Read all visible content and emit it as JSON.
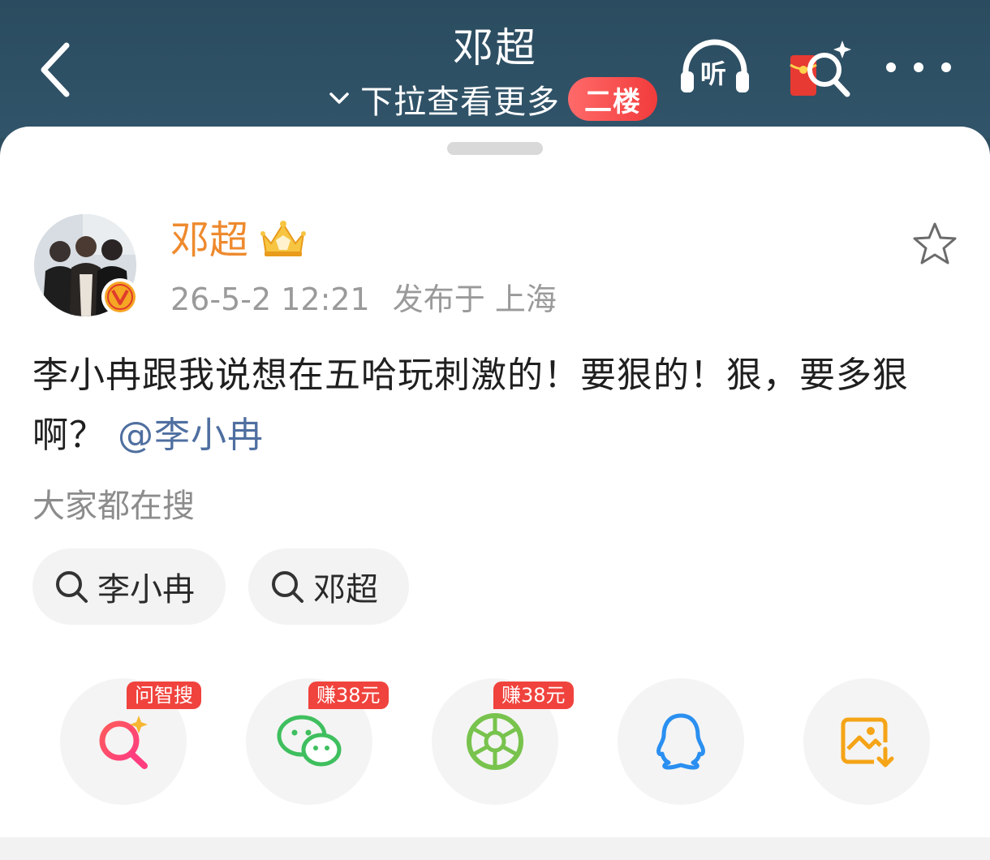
{
  "header": {
    "title": "邓超",
    "pull_text": "下拉查看更多",
    "floor_badge": "二楼",
    "listen_label": "听"
  },
  "post": {
    "author": "邓超",
    "time": "26-5-2 12:21",
    "location": "发布于 上海",
    "text": "李小冉跟我说想在五哈玩刺激的！要狠的！狠，要多狠啊？",
    "mention": "@李小冉"
  },
  "search": {
    "label": "大家都在搜",
    "chips": [
      "李小冉",
      "邓超"
    ]
  },
  "share": {
    "tags": [
      "问智搜",
      "赚38元",
      "赚38元"
    ],
    "items": [
      "smart-search-icon",
      "wechat-icon",
      "moments-icon",
      "qq-icon",
      "save-image-icon"
    ]
  },
  "colors": {
    "nav_bg": "#2e4e60",
    "author": "#ee8a2e",
    "mention": "#4f6fa0",
    "badge": "#f0433d"
  }
}
